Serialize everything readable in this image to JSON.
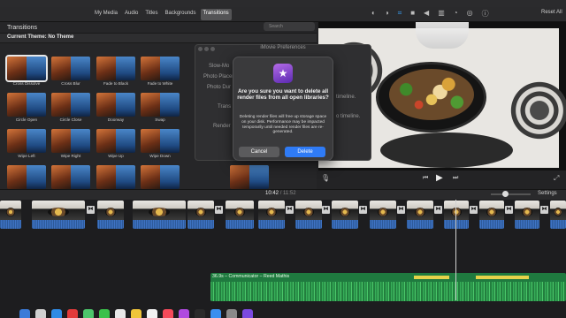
{
  "toolbar": {
    "tabs": [
      "My Media",
      "Audio",
      "Titles",
      "Backgrounds",
      "Transitions"
    ],
    "active_tab": "Transitions",
    "reset_all": "Reset All",
    "search_placeholder": "Search"
  },
  "browser": {
    "title": "Transitions",
    "theme_label": "Current Theme: No Theme",
    "transitions": [
      "Cross Dissolve",
      "Cross Blur",
      "Fade to Black",
      "Fade to White",
      "Circle Open",
      "Circle Close",
      "Doorway",
      "Swap",
      "Wipe Left",
      "Wipe Right",
      "Wipe Up",
      "Wipe Down"
    ],
    "selected": "Cross Dissolve"
  },
  "prefs_window": {
    "title": "iMovie Preferences",
    "labels": [
      "Slow-Mo",
      "Photo Placem",
      "Photo Dur",
      "Trans",
      "Render"
    ],
    "right_labels": [
      "timeline.",
      "o timeline."
    ]
  },
  "dialog": {
    "heading": "Are you sure you want to delete all render files from all open libraries?",
    "body": "Deleting render files will free up storage space on your disk. Performance may be impacted temporarily until needed render files are re-generated.",
    "cancel_label": "Cancel",
    "delete_label": "Delete",
    "accent": "#2f7bf6"
  },
  "timeline": {
    "timecode": "10:42",
    "duration": "/ 11:52",
    "settings_label": "Settings",
    "audio_clip_label": "36.9s – Communicator – Reed Mathis"
  }
}
